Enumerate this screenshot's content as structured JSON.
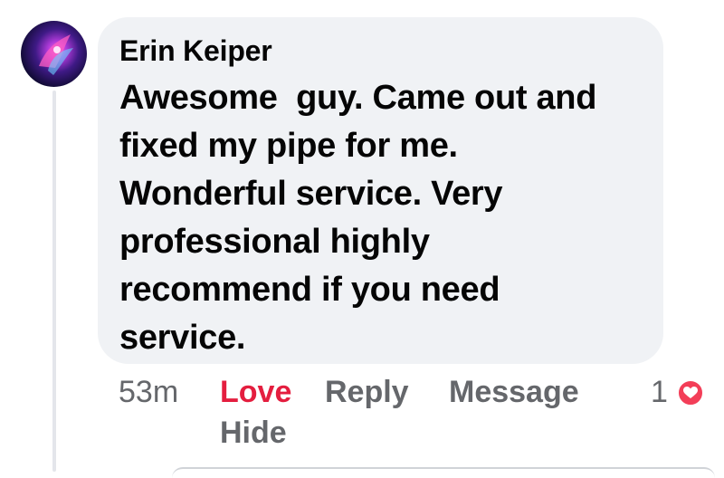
{
  "comment": {
    "author": "Erin Keiper",
    "text": "Awesome  guy. Came out and\nfixed my pipe for me.\nWonderful service. Very\nprofessional highly\nrecommend if you need\nservice.",
    "timestamp": "53m"
  },
  "actions": {
    "love_label": "Love",
    "reply_label": "Reply",
    "message_label": "Message",
    "hide_label": "Hide"
  },
  "reactions": {
    "count": "1",
    "icon": "heart-icon",
    "color": "#f33e58"
  },
  "colors": {
    "love_active": "#e41e3f",
    "bubble": "#f0f2f5",
    "secondary_text": "#65676b"
  }
}
